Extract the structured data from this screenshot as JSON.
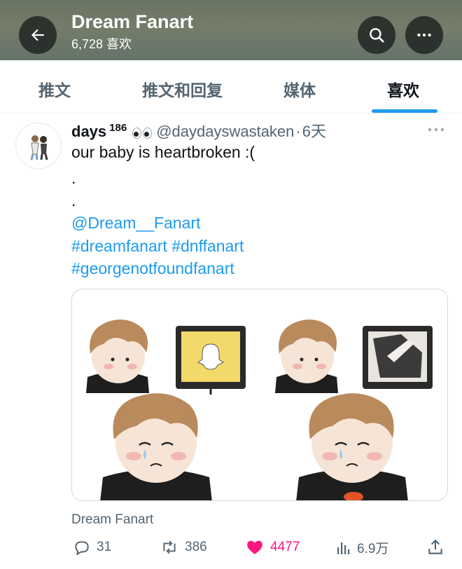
{
  "header": {
    "title": "Dream Fanart",
    "subtitle": "6,728 喜欢",
    "back_icon": "arrow-left-icon",
    "search_icon": "search-icon",
    "more_icon": "more-horizontal-icon"
  },
  "tabs": [
    {
      "label": "推文",
      "active": false
    },
    {
      "label": "推文和回复",
      "active": false
    },
    {
      "label": "媒体",
      "active": false
    },
    {
      "label": "喜欢",
      "active": true
    }
  ],
  "tweet": {
    "display_name": "days",
    "name_suffix": "186",
    "handle": "@daydayswastaken",
    "separator": "·",
    "time": "6天",
    "text": "our baby is heartbroken  :(",
    "line_dot_1": ".",
    "line_dot_2": ".",
    "mention": "@Dream__Fanart",
    "hashtags_line1": "#dreamfanart #dnffanart",
    "hashtags_line2": "#georgenotfoundfanart",
    "attribution": "Dream Fanart"
  },
  "actions": {
    "replies": "31",
    "retweets": "386",
    "likes": "4477",
    "views": "6.9万"
  },
  "colors": {
    "accent": "#1d9bf0",
    "like": "#f91880",
    "secondary_text": "#536471"
  }
}
